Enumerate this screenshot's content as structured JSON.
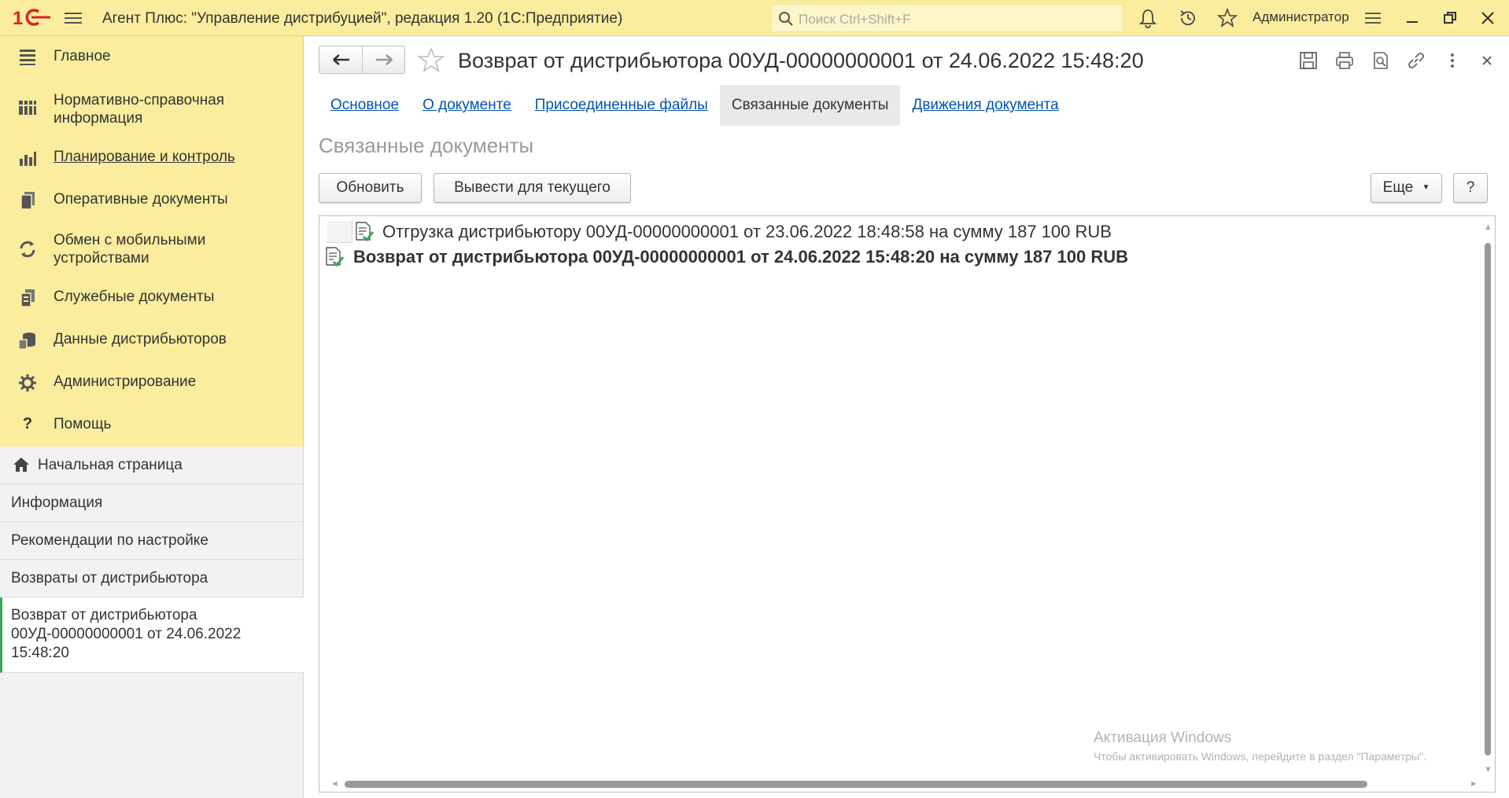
{
  "app": {
    "logo_text": "1С",
    "title": "Агент Плюс: \"Управление дистрибуцией\", редакция 1.20  (1С:Предприятие)",
    "search_placeholder": "Поиск Ctrl+Shift+F",
    "user": "Администратор"
  },
  "sidebar": {
    "items": [
      {
        "label": "Главное",
        "icon": "menu-list-icon"
      },
      {
        "label": "Нормативно-справочная информация",
        "icon": "catalog-icon"
      },
      {
        "label": "Планирование и контроль",
        "icon": "bar-chart-icon"
      },
      {
        "label": "Оперативные документы",
        "icon": "documents-icon"
      },
      {
        "label": "Обмен с мобильными устройствами",
        "icon": "sync-icon"
      },
      {
        "label": "Служебные документы",
        "icon": "service-docs-icon"
      },
      {
        "label": "Данные дистрибьюторов",
        "icon": "distributor-data-icon"
      },
      {
        "label": "Администрирование",
        "icon": "gear-icon"
      },
      {
        "label": "Помощь",
        "icon": "question-icon"
      }
    ]
  },
  "open_windows": {
    "items": [
      {
        "label": "Начальная страница"
      },
      {
        "label": "Информация"
      },
      {
        "label": "Рекомендации по настройке"
      },
      {
        "label": "Возвраты от дистрибьютора"
      },
      {
        "label_lines": [
          "Возврат от дистрибьютора",
          "00УД-00000000001 от 24.06.2022",
          "15:48:20"
        ]
      }
    ]
  },
  "document": {
    "title": "Возврат от дистрибьютора 00УД-00000000001 от 24.06.2022 15:48:20",
    "tabs": [
      "Основное",
      "О документе",
      "Присоединенные файлы",
      "Связанные документы",
      "Движения документа"
    ],
    "active_tab": "Связанные документы",
    "section_title": "Связанные документы",
    "buttons": {
      "refresh": "Обновить",
      "show_for_current": "Вывести для текущего",
      "more": "Еще",
      "help": "?"
    },
    "rows": [
      {
        "text": "Отгрузка дистрибьютору 00УД-00000000001 от 23.06.2022 18:48:58 на сумму 187 100 RUB",
        "bold": false
      },
      {
        "text": "Возврат от дистрибьютора 00УД-00000000001 от 24.06.2022 15:48:20 на сумму 187 100 RUB",
        "bold": true
      }
    ]
  },
  "watermark": {
    "line1": "Активация Windows",
    "line2": "Чтобы активировать Windows, перейдите в раздел \"Параметры\"."
  },
  "colors": {
    "panel_yellow": "#fbed9e",
    "link_blue": "#0055b5",
    "logo_red": "#d6232a",
    "check_green": "#3aa55b"
  }
}
